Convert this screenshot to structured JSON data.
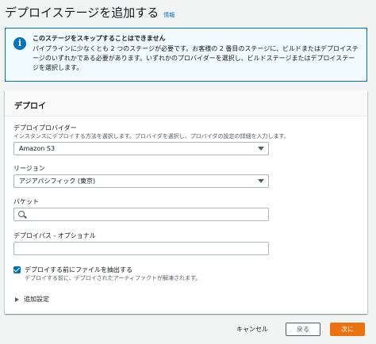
{
  "header": {
    "title": "デプロイステージを追加する",
    "info_link": "情報"
  },
  "alert": {
    "title": "このステージをスキップすることはできません",
    "body": "パイプラインに少なくとも 2 つのステージが必要です。お客様の 2 番目のステージに、ビルドまたはデプロイステージのいずれかである必要があります。いずれかのプロバイダーを選択し、ビルドステージまたはデプロイステージを選択します。"
  },
  "panel": {
    "title": "デプロイ",
    "provider": {
      "label": "デプロイプロバイダー",
      "description": "インスタンスにデプロイする方法を選択します。プロバイダを選択し、プロバイダの設定の詳細を入力します。",
      "value": "Amazon S3"
    },
    "region": {
      "label": "リージョン",
      "value": "アジアパシフィック (東京)"
    },
    "bucket": {
      "label": "バケット",
      "value": ""
    },
    "deploy_path": {
      "label": "デプロイパス - オプショナル",
      "value": ""
    },
    "extract": {
      "label": "デプロイする前にファイルを抽出する",
      "description": "デプロイする前に、デプロイされたアーティファクトが解凍されます。",
      "checked": true
    },
    "additional_settings": "追加設定"
  },
  "footer": {
    "cancel": "キャンセル",
    "back": "戻る",
    "next": "次に"
  }
}
